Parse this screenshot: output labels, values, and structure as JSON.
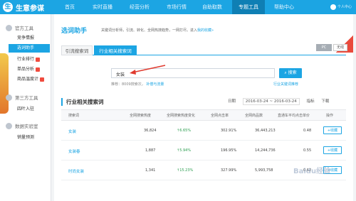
{
  "app": {
    "logo_mark": "生",
    "logo_text": "生意参谋"
  },
  "nav": {
    "items": [
      "首页",
      "实时直播",
      "经营分析",
      "市场行情",
      "自助取数",
      "专题工具",
      "帮助中心"
    ],
    "user": "个人中心"
  },
  "sidebar": {
    "groups": [
      {
        "label": "官方工具",
        "items": [
          "竞争情报",
          "选词助手",
          "行业排行",
          "单品分析",
          "商品温度计"
        ]
      },
      {
        "label": "第三方工具",
        "items": [
          "四叶入驻"
        ]
      },
      {
        "label": "数据实验室",
        "items": [
          "销量预测"
        ]
      }
    ],
    "active_item": "选词助手"
  },
  "page": {
    "title": "选词助手",
    "desc": "关键词分析师，引流、转化、全网热搜趋势，一网打尽。进入",
    "desc_link": "我的收藏»",
    "tabs": [
      "引流搜索词",
      "行业相关搜索词"
    ],
    "active_tab": 1,
    "pc": "PC",
    "wx": "无线"
  },
  "search": {
    "value": "女装",
    "button": "搜索",
    "hint": "推荐：8009搜索次，",
    "hint_link": "补偿与流量",
    "hint_right": "行业关键词推荐"
  },
  "section": {
    "title": "行业相关搜索词",
    "date_label": "日期",
    "date_range": "2016-03-24 ~ 2016-03-24",
    "metric": "指标",
    "download": "下载"
  },
  "table": {
    "headers": [
      "搜索词",
      "全网搜索热度",
      "全网搜索热度变化",
      "全网点击率",
      "全网商品数",
      "直通车平均点击单价",
      "操作"
    ],
    "rows": [
      {
        "kw": "女装",
        "heat": "36,824",
        "change": "6.65%",
        "ctr": "302.91%",
        "items": "36,443,213",
        "cpc": "0.48",
        "op": "收藏"
      },
      {
        "kw": "女装春",
        "heat": "1,887",
        "change": "5.94%",
        "ctr": "196.95%",
        "items": "14,244,736",
        "cpc": "0.55",
        "op": "收藏"
      },
      {
        "kw": "时尚女装",
        "heat": "1,341",
        "change": "15.23%",
        "ctr": "327.99%",
        "items": "5,993,758",
        "cpc": "0.62",
        "op": "收藏"
      }
    ]
  },
  "watermark": "Baidu经验"
}
